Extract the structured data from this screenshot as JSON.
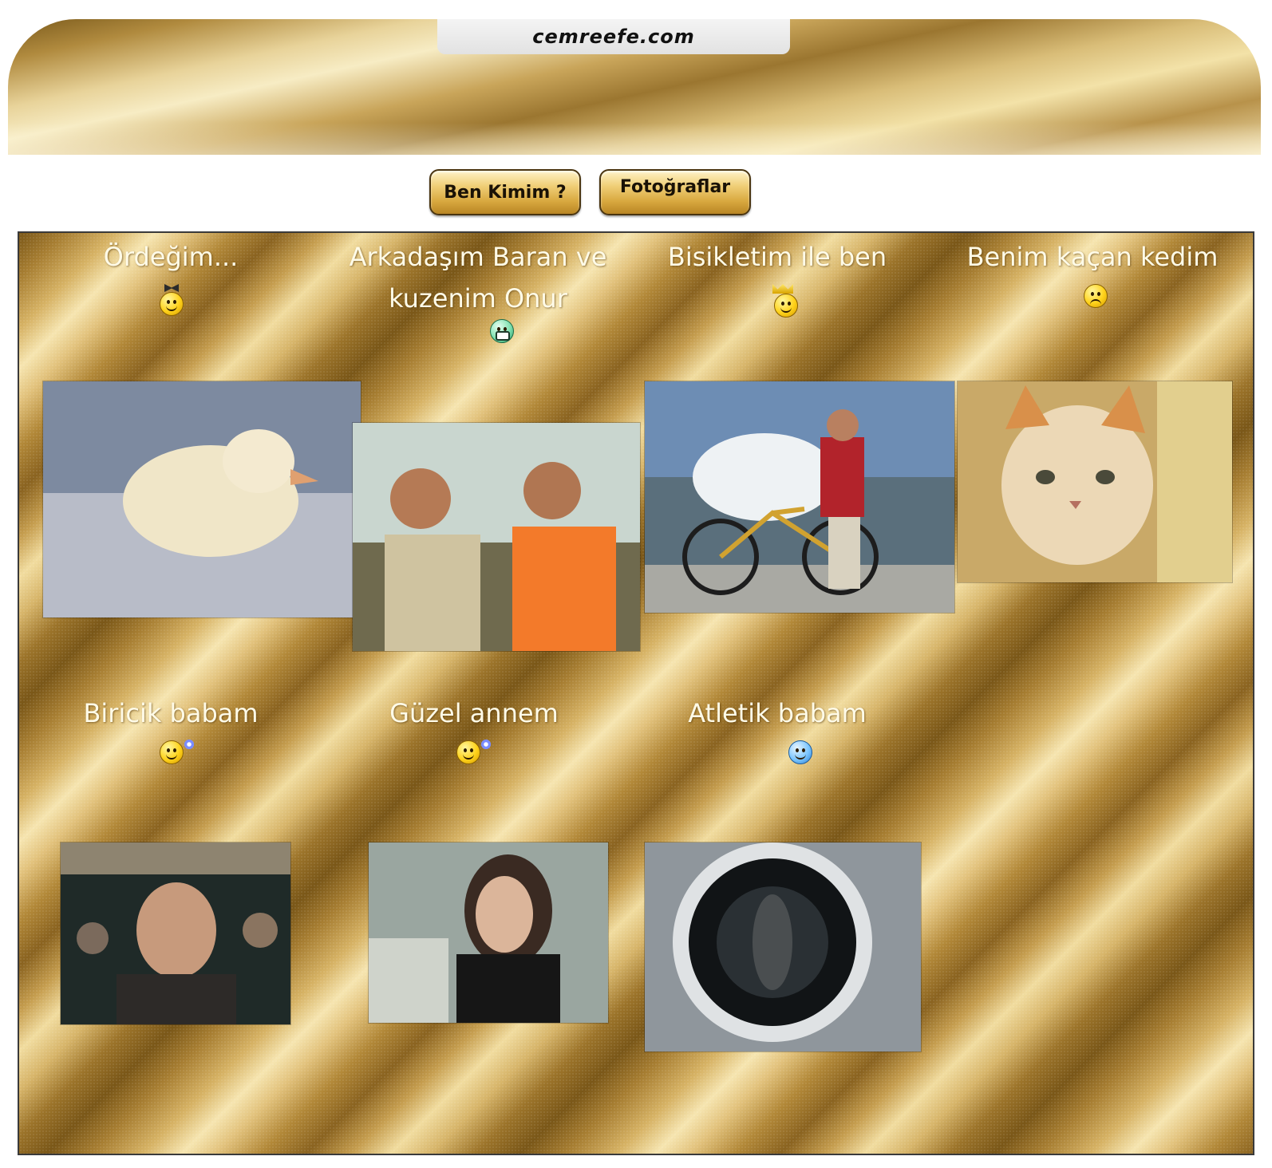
{
  "header": {
    "site_name": "cemreefe.com"
  },
  "nav": {
    "buttons": [
      {
        "label": "Ben Kimim ?"
      },
      {
        "label": "Fotoğraflar"
      }
    ]
  },
  "gallery": {
    "items": [
      {
        "caption": "Ördeğim...",
        "emoticon": "smiley-bow-icon"
      },
      {
        "caption": "Arkadaşım Baran ve kuzenim Onur",
        "emoticon": "grin-icon"
      },
      {
        "caption": "Bisikletim ile ben",
        "emoticon": "smiley-crown-icon"
      },
      {
        "caption": "Benim kaçan kedim",
        "emoticon": "sad-smiley-icon"
      },
      {
        "caption": "Biricik babam",
        "emoticon": "smiley-flower-icon"
      },
      {
        "caption": "Güzel annem",
        "emoticon": "smiley-flower-icon"
      },
      {
        "caption": "Atletik babam",
        "emoticon": "blue-smiley-icon"
      }
    ]
  },
  "colors": {
    "gold_light": "#f6e5b0",
    "gold_dark": "#7a5718",
    "caption_text": "#fffbe8",
    "button_border": "#4a3510"
  }
}
